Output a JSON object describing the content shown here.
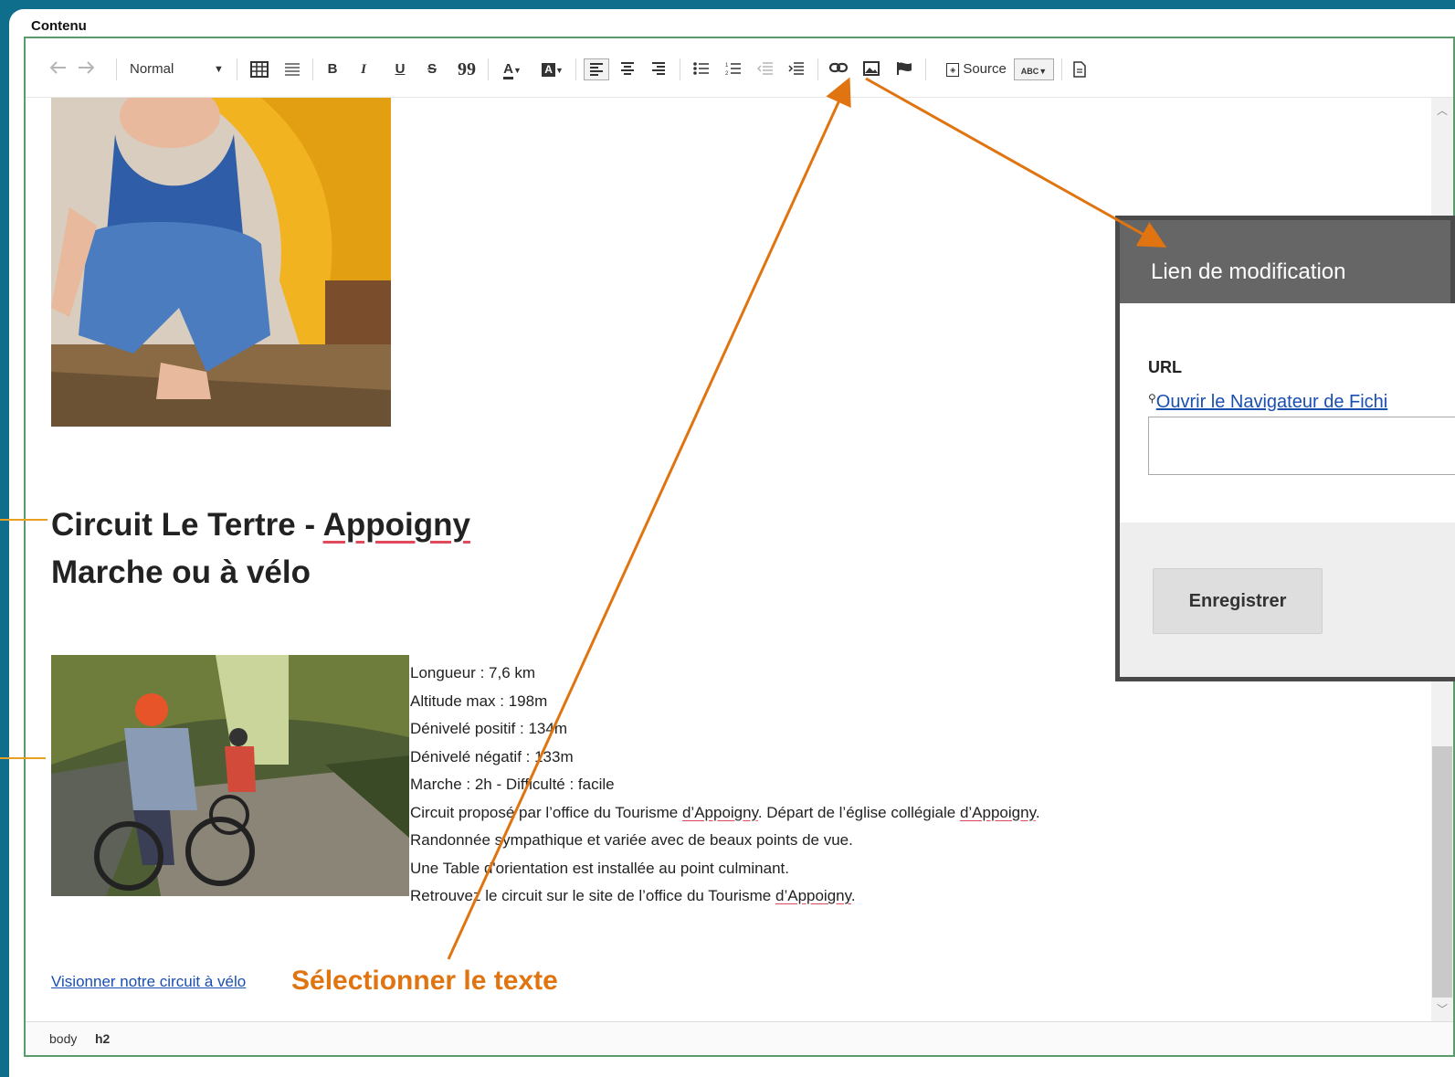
{
  "frame": {
    "title": "Contenu"
  },
  "toolbar": {
    "format_value": "Normal",
    "source_label": "Source",
    "icons": [
      "undo-icon",
      "redo-icon",
      "table-icon",
      "horizontal-rule-icon",
      "bold-icon",
      "italic-icon",
      "underline-icon",
      "strikethrough-icon",
      "blockquote-icon",
      "text-color-icon",
      "background-color-icon",
      "align-left-icon",
      "align-center-icon",
      "align-right-icon",
      "bulleted-list-icon",
      "numbered-list-icon",
      "outdent-icon",
      "indent-icon",
      "link-icon",
      "image-icon",
      "anchor-flag-icon",
      "source-icon",
      "spellcheck-icon",
      "templates-icon"
    ],
    "bold_glyph": "B",
    "italic_glyph": "I",
    "underline_glyph": "U",
    "strike_glyph": "S",
    "quote_glyph": "99",
    "color_glyph": "A",
    "spell_glyph": "ABC"
  },
  "content": {
    "heading_line1_a": "Circuit Le Tertre - ",
    "heading_line1_b": "Appoigny",
    "heading_line2": "Marche ou à vélo",
    "details": [
      "Longueur : 7,6 km",
      "Altitude max : 198m",
      "Dénivelé positif : 134m",
      "Dénivelé négatif : 133m",
      "Marche : 2h - Difficulté : facile"
    ],
    "detail6_a": "Circuit proposé par l’office du Tourisme ",
    "detail6_b": "d’Appoigny",
    "detail6_c": ". Départ de l’église collégiale ",
    "detail6_d": "d’Appoigny",
    "detail6_e": ".",
    "detail7": "Randonnée sympathique et variée avec de beaux points de vue.",
    "detail8": "Une Table d'orientation est installée au point culminant.",
    "detail9_a": "Retrouvez le circuit sur le site de l’office du Tourisme ",
    "detail9_b": "d’Appoigny",
    "detail9_c": ".",
    "link_text": "Visionner notre circuit à vélo"
  },
  "status": {
    "path1": "body",
    "path2": "h2"
  },
  "dialog": {
    "title": "Lien de modification",
    "url_label": "URL",
    "browse_link": "Ouvrir le Navigateur de Fichi",
    "url_value": "",
    "save_label": "Enregistrer"
  },
  "annotation": {
    "text": "Sélectionner le texte",
    "color": "#e07410"
  },
  "colors": {
    "frame": "#0f6e8c",
    "editor_border": "#5a9b6e",
    "dialog_header": "#666666",
    "link": "#1a4fb0"
  }
}
